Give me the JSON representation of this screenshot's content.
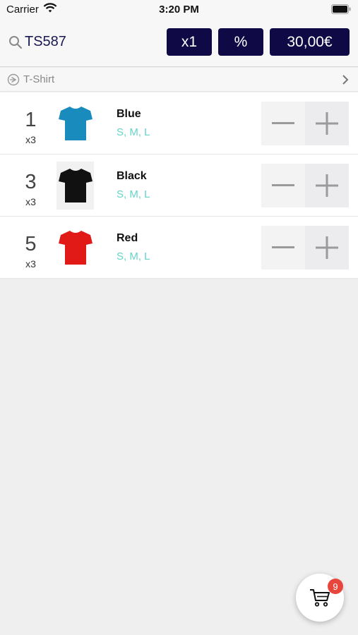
{
  "status_bar": {
    "carrier": "Carrier",
    "time": "3:20 PM",
    "icons": [
      "wifi-icon",
      "battery-icon"
    ]
  },
  "header": {
    "search_text": "TS587",
    "qty_button": "x1",
    "percent_button": "%",
    "price_button": "30,00€",
    "button_color": "#0f0a45"
  },
  "category": {
    "label": "T-Shirt",
    "icon": "category-icon"
  },
  "products": [
    {
      "number": "1",
      "multiplier": "x3",
      "name": "Blue",
      "sizes": "S, M, L",
      "color": "#1a8bbd"
    },
    {
      "number": "3",
      "multiplier": "x3",
      "name": "Black",
      "sizes": "S, M, L",
      "color": "#111111"
    },
    {
      "number": "5",
      "multiplier": "x3",
      "name": "Red",
      "sizes": "S, M, L",
      "color": "#e21a17"
    }
  ],
  "cart": {
    "badge_count": "9",
    "badge_color": "#e8453c"
  },
  "colors": {
    "sizes_text": "#67d4c8",
    "background": "#efefef"
  }
}
